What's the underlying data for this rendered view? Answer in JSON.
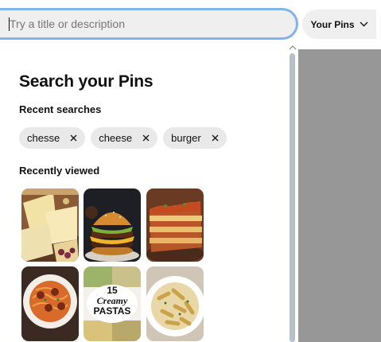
{
  "search": {
    "placeholder": "Try a title or description",
    "value": ""
  },
  "filter": {
    "label": "Your Pins",
    "icon": "chevron-down-icon"
  },
  "panel": {
    "title": "Search your Pins",
    "recent_label": "Recent searches",
    "recent_searches": [
      "chesse",
      "cheese",
      "burger"
    ],
    "viewed_label": "Recently viewed",
    "pins": [
      {
        "subject": "cheese-board-image"
      },
      {
        "subject": "burger-image"
      },
      {
        "subject": "lasagna-image"
      },
      {
        "subject": "spaghetti-meatballs-image"
      },
      {
        "subject": "pasta-collage-image",
        "title_lines": [
          "15",
          "Creamy",
          "PASTAS"
        ]
      },
      {
        "subject": "penne-pasta-image"
      }
    ]
  },
  "colors": {
    "focus_ring": "#7fb4ec",
    "chip_bg": "#e9e9e9",
    "scroll_thumb": "#b7bfc7",
    "overlay": "#979797"
  }
}
